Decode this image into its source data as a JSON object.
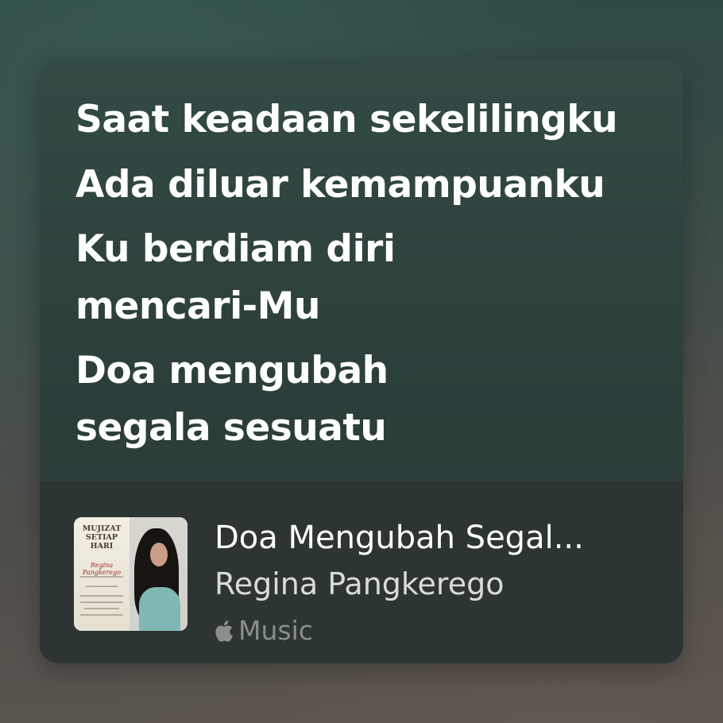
{
  "lyrics": [
    "Saat keadaan sekelilingku",
    "Ada diluar kemampuanku",
    "Ku berdiam diri\nmencari-Mu",
    "Doa mengubah\nsegala sesuatu"
  ],
  "now_playing": {
    "title": "Doa Mengubah Segal...",
    "artist": "Regina Pangkerego",
    "service": "Music",
    "service_icon": "apple-logo-icon"
  },
  "album_art": {
    "title": "MUJIZAT\nSETIAP\nHARI",
    "artist_signature": "Regina Pangkerego"
  },
  "colors": {
    "lyric_text": "#ffffff",
    "title_text": "#ffffff",
    "artist_text": "#d1d1d1",
    "service_text": "#8a8f8d",
    "card_bg": "#2f443f",
    "footer_bg": "#2c3533"
  }
}
